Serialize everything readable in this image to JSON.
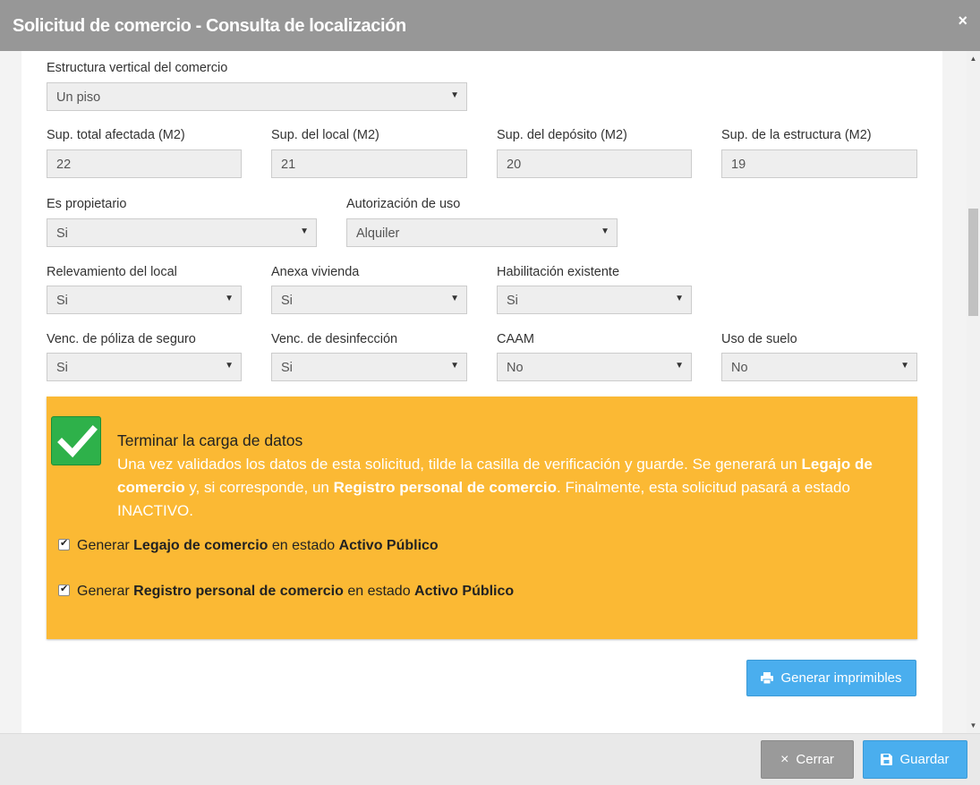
{
  "window": {
    "title": "Solicitud de comercio - Consulta de localización",
    "close_glyph": "×"
  },
  "form": {
    "estructura": {
      "label": "Estructura vertical del comercio",
      "value": "Un piso"
    },
    "sup_total": {
      "label": "Sup. total afectada (M2)",
      "value": "22"
    },
    "sup_local": {
      "label": "Sup. del local (M2)",
      "value": "21"
    },
    "sup_deposito": {
      "label": "Sup. del depósito (M2)",
      "value": "20"
    },
    "sup_estructura": {
      "label": "Sup. de la estructura (M2)",
      "value": "19"
    },
    "propietario": {
      "label": "Es propietario",
      "value": "Si"
    },
    "autorizacion": {
      "label": "Autorización de uso",
      "value": "Alquiler"
    },
    "relevamiento": {
      "label": "Relevamiento del local",
      "value": "Si"
    },
    "anexa": {
      "label": "Anexa vivienda",
      "value": "Si"
    },
    "habilitacion": {
      "label": "Habilitación existente",
      "value": "Si"
    },
    "poliza": {
      "label": "Venc. de póliza de seguro",
      "value": "Si"
    },
    "desinfeccion": {
      "label": "Venc. de desinfección",
      "value": "Si"
    },
    "caam": {
      "label": "CAAM",
      "value": "No"
    },
    "uso_suelo": {
      "label": "Uso de suelo",
      "value": "No"
    }
  },
  "notice": {
    "title": "Terminar la carga de datos",
    "body": {
      "t1": "Una vez validados los datos de esta solicitud, tilde la casilla de verificación y guarde. Se generará un ",
      "b1": "Legajo de comercio",
      "t2": " y, si corresponde, un ",
      "b2": "Registro personal de comercio",
      "t3": ". Finalmente, esta solicitud pasará a estado INACTIVO."
    },
    "option1": {
      "prefix": "Generar ",
      "bold": "Legajo de comercio",
      "middle": " en estado ",
      "state": "Activo Público"
    },
    "option2": {
      "prefix": "Generar ",
      "bold": "Registro personal de comercio",
      "middle": " en estado ",
      "state": "Activo Público"
    }
  },
  "buttons": {
    "print": "Generar imprimibles",
    "close": "Cerrar",
    "save": "Guardar"
  },
  "colors": {
    "notice_bg": "#fbb934",
    "check_green": "#2eb14a",
    "primary_blue": "#4aaeee",
    "titlebar": "#979797"
  },
  "icons": [
    "close-icon",
    "check-icon",
    "printer-icon",
    "floppy-disk-icon",
    "caret-down-icon"
  ]
}
